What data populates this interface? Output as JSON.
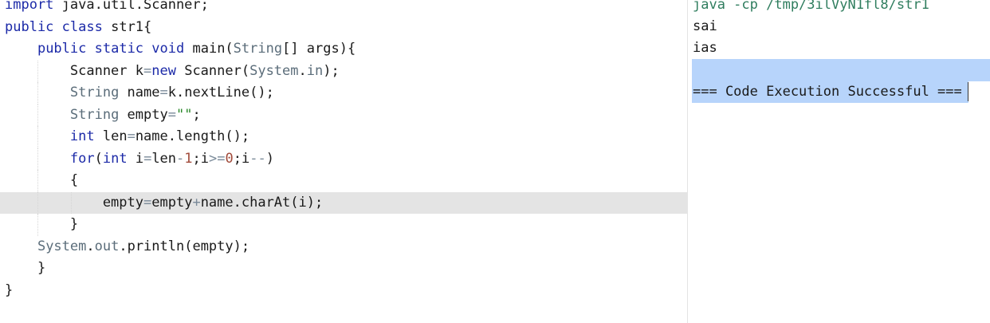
{
  "editor": {
    "lines": [
      [
        {
          "text": "import",
          "c": "k"
        },
        {
          "text": " java.util.Scanner;"
        }
      ],
      [
        {
          "text": "public",
          "c": "k"
        },
        {
          "text": " "
        },
        {
          "text": "class",
          "c": "k"
        },
        {
          "text": " str1{"
        }
      ],
      [
        {
          "text": "    "
        },
        {
          "text": "public",
          "c": "k"
        },
        {
          "text": " "
        },
        {
          "text": "static",
          "c": "k"
        },
        {
          "text": " "
        },
        {
          "text": "void",
          "c": "k"
        },
        {
          "text": " main("
        },
        {
          "text": "String",
          "c": "t"
        },
        {
          "text": "[] args){"
        }
      ],
      [
        {
          "text": "        Scanner k"
        },
        {
          "text": "=",
          "c": "o"
        },
        {
          "text": "new",
          "c": "k"
        },
        {
          "text": " Scanner("
        },
        {
          "text": "System",
          "c": "t"
        },
        {
          "text": "."
        },
        {
          "text": "in",
          "c": "t"
        },
        {
          "text": ");"
        }
      ],
      [
        {
          "text": "        "
        },
        {
          "text": "String",
          "c": "t"
        },
        {
          "text": " name"
        },
        {
          "text": "=",
          "c": "o"
        },
        {
          "text": "k.nextLine();"
        }
      ],
      [
        {
          "text": "        "
        },
        {
          "text": "String",
          "c": "t"
        },
        {
          "text": " empty"
        },
        {
          "text": "=",
          "c": "o"
        },
        {
          "text": "\"\"",
          "c": "s"
        },
        {
          "text": ";"
        }
      ],
      [
        {
          "text": "        "
        },
        {
          "text": "int",
          "c": "k"
        },
        {
          "text": " len"
        },
        {
          "text": "=",
          "c": "o"
        },
        {
          "text": "name.length();"
        }
      ],
      [
        {
          "text": "        "
        },
        {
          "text": "for",
          "c": "k"
        },
        {
          "text": "("
        },
        {
          "text": "int",
          "c": "k"
        },
        {
          "text": " i"
        },
        {
          "text": "=",
          "c": "o"
        },
        {
          "text": "len"
        },
        {
          "text": "-",
          "c": "o"
        },
        {
          "text": "1",
          "c": "n"
        },
        {
          "text": ";i"
        },
        {
          "text": ">=",
          "c": "o"
        },
        {
          "text": "0",
          "c": "n"
        },
        {
          "text": ";i"
        },
        {
          "text": "--",
          "c": "o"
        },
        {
          "text": ")"
        }
      ],
      [
        {
          "text": "        {"
        }
      ],
      [
        {
          "text": "            empty"
        },
        {
          "text": "=",
          "c": "o"
        },
        {
          "text": "empty"
        },
        {
          "text": "+",
          "c": "o"
        },
        {
          "text": "name.charAt(i);"
        }
      ],
      [
        {
          "text": "        }"
        }
      ],
      [
        {
          "text": "    "
        },
        {
          "text": "System",
          "c": "t"
        },
        {
          "text": "."
        },
        {
          "text": "out",
          "c": "t"
        },
        {
          "text": ".println(empty);"
        }
      ],
      [
        {
          "text": "    }"
        }
      ],
      [
        {
          "text": "}"
        }
      ]
    ]
  },
  "output": {
    "command": "java -cp /tmp/3ilVyN1fl8/str1",
    "lines": [
      "sai",
      "ias",
      "",
      "=== Code Execution Successful ==="
    ]
  }
}
